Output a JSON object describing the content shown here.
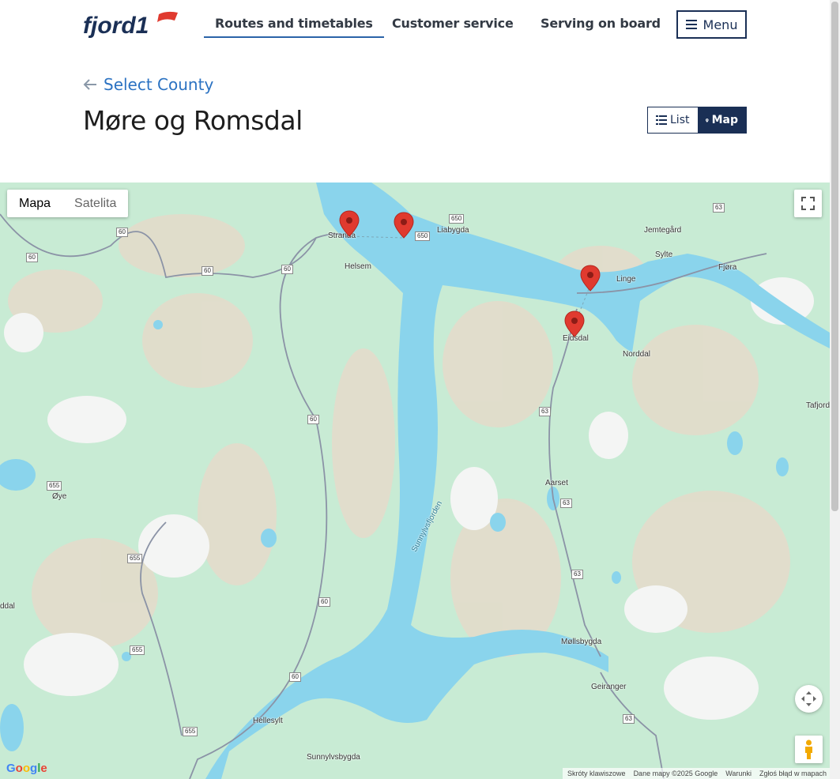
{
  "header": {
    "logo_text": "fjord1",
    "nav": [
      {
        "label": "Routes and timetables",
        "active": true
      },
      {
        "label": "Customer service",
        "active": false
      },
      {
        "label": "Serving on board",
        "active": false
      }
    ],
    "menu_label": "Menu"
  },
  "breadcrumb": {
    "back_label": "Select County",
    "icon": "arrow-left-icon"
  },
  "page": {
    "title": "Møre og Romsdal"
  },
  "view_toggle": {
    "list_label": "List",
    "map_label": "Map",
    "selected": "Map"
  },
  "map": {
    "type_controls": {
      "map": "Mapa",
      "satellite": "Satelita",
      "selected": "Mapa"
    },
    "places": [
      "Stranda",
      "Helsem",
      "Liabygda",
      "Jemtegård",
      "Sylte",
      "Fjøra",
      "Linge",
      "Eidsdal",
      "Norddal",
      "Tafjord",
      "Aarset",
      "Øye",
      "ddal",
      "Møllsbygda",
      "Geiranger",
      "Hellesylt",
      "Sunnylvsbygda",
      "Sunnylvsfjorden"
    ],
    "roads": [
      "60",
      "60",
      "60",
      "60",
      "60",
      "60",
      "60",
      "650",
      "650",
      "63",
      "63",
      "63",
      "63",
      "63",
      "655",
      "655",
      "655",
      "655"
    ],
    "markers": [
      "Stranda",
      "Liabygda",
      "Linge",
      "Eidsdal"
    ],
    "attribution": [
      "Skróty klawiszowe",
      "Dane mapy ©2025 Google",
      "Warunki",
      "Zgłoś błąd w mapach"
    ],
    "google_logo": "Google"
  },
  "colors": {
    "brand_navy": "#1a2f55",
    "link_blue": "#2b72c2",
    "marker_red": "#e03a2f",
    "water": "#8ad4ec"
  }
}
